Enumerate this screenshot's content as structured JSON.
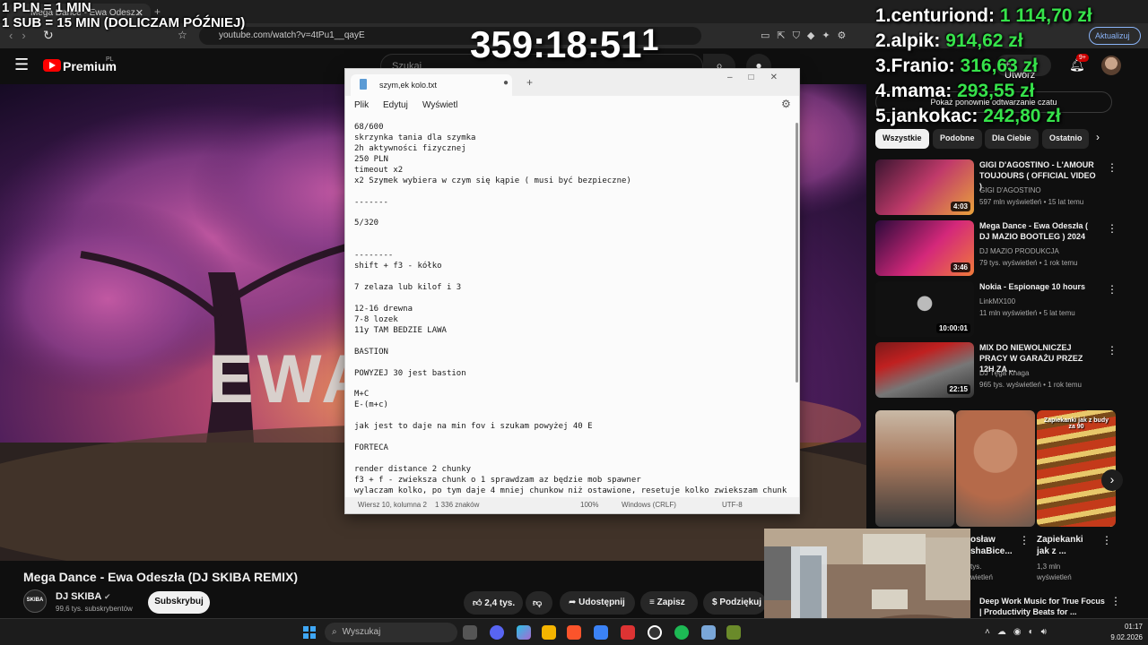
{
  "overlay": {
    "rules": [
      "1 PLN = 1 MIN",
      "1 SUB = 15 MIN (DOLICZAM PÓŹNIEJ)"
    ],
    "timer": "359:18:51",
    "timer_suffix": "1",
    "leaderboard": [
      {
        "rank": "1.",
        "name": "centuriond:",
        "amount": "1 114,70 zł"
      },
      {
        "rank": "2.",
        "name": "alpik:",
        "amount": "914,62 zł"
      },
      {
        "rank": "3.",
        "name": "Franio:",
        "amount": "316,63 zł"
      },
      {
        "rank": "4.",
        "name": "mama:",
        "amount": "293,55 zł"
      },
      {
        "rank": "5.",
        "name": "jankokac:",
        "amount": "242,80 zł"
      }
    ]
  },
  "browser": {
    "tab_title": "Mega Dance - Ewa Odesz...",
    "url": "youtube.com/watch?v=4tPu1__qayE",
    "update_label": "Aktualizuj"
  },
  "youtube": {
    "logo_text": "Premium",
    "logo_sup": "PL",
    "search_placeholder": "Szukaj",
    "create_label": "+ Utwórz",
    "notifications_badge": "9+"
  },
  "video": {
    "overlay_text": "EWA",
    "title": "Mega Dance - Ewa Odeszła (DJ SKIBA REMIX)",
    "channel": "DJ SKIBA",
    "channel_avatar_text": "SKIBA",
    "subscribers": "99,6 tys. subskrybentów",
    "subscribe_label": "Subskrybuj",
    "likes": "2,4 tys.",
    "share_label": "Udostępnij",
    "save_label": "Zapisz",
    "thanks_label": "Podziękuj"
  },
  "sidebar": {
    "chat_button": "Pokaż ponownie odtwarzanie czatu",
    "chips": [
      "Wszystkie",
      "Podobne",
      "Dla Ciebie",
      "Ostatnio"
    ],
    "recommendations": [
      {
        "title": "GIGI D'AGOSTINO - L'AMOUR TOUJOURS ( OFFICIAL VIDEO )",
        "channel": "GIGI D'AGOSTINO",
        "meta": "597 mln wyświetleń • 15 lat temu",
        "duration": "4:03"
      },
      {
        "title": "Mega Dance - Ewa Odeszła ( DJ MAZIO BOOTLEG ) 2024",
        "channel": "DJ MAZIO PRODUKCJA",
        "meta": "79 tys. wyświetleń • 1 rok temu",
        "duration": "3:46"
      },
      {
        "title": "Nokia - Espionage 10 hours",
        "channel": "LinkMX100",
        "meta": "11 mln wyświetleń • 5 lat temu",
        "duration": "10:00:01"
      },
      {
        "title": "MIX DO NIEWOLNICZEJ PRACY W GARAŻU PRZEZ 12H ZA ...",
        "channel": "DJ Tęga Knaga",
        "meta": "965 tys. wyświetleń • 1 rok temu",
        "duration": "22:15"
      }
    ],
    "shorts": [
      {
        "title": "",
        "meta": ""
      },
      {
        "title": "osław\nshaBice...",
        "meta": "tys.\nwietleń"
      },
      {
        "title": "Zapiekanki\njak z ...",
        "meta": "1,3 mln\nwyświetleń"
      }
    ],
    "short3_caption": "Zapiekanki jak z budy za 90",
    "bottom_rec": "Deep Work Music for True Focus | Productivity Beats for ..."
  },
  "notepad": {
    "tab_title": "szym,ek kolo.txt",
    "menu": [
      "Plik",
      "Edytuj",
      "Wyświetl"
    ],
    "lines": [
      "68/600",
      "skrzynka tania dla szymka",
      "2h aktywności fizycznej",
      "250 PLN",
      "timeout x2",
      "x2 Szymek wybiera w czym się kąpie ( musi być bezpieczne)",
      "",
      "-------",
      "",
      "5/320",
      "",
      "",
      "--------",
      "shift + f3 - kółko",
      "",
      "7 zelaza lub kilof i 3",
      "",
      "12-16 drewna",
      "7-8 lozek",
      "11y TAM BEDZIE LAWA",
      "",
      "BASTION",
      "",
      "POWYZEJ 30 jest bastion",
      "",
      "M+C",
      "E-(m+c)",
      "",
      "jak jest to daje na min fov i szukam powyżej 40 E",
      "",
      "FORTECA",
      "",
      "render distance 2 chunky",
      "f3 + f - zwieksza chunk o 1 sprawdzam az będzie mob spawner",
      "wylaczam kolko, po tym daje 4 mniej chunkow niż ostawione, resetuje kolko zwiekszam chunki"
    ],
    "status": {
      "position": "Wiersz 10, kolumna 2",
      "chars": "1 336 znaków",
      "zoom": "100%",
      "line_endings": "Windows (CRLF)",
      "encoding": "UTF-8"
    }
  },
  "taskbar": {
    "search_placeholder": "Wyszukaj",
    "time": "01:17",
    "date": "9.02.2026"
  },
  "colors": {
    "leaderboard_amount": "#36e24a",
    "youtube_red": "#ff0000",
    "yt_background": "#0f0f0f"
  }
}
